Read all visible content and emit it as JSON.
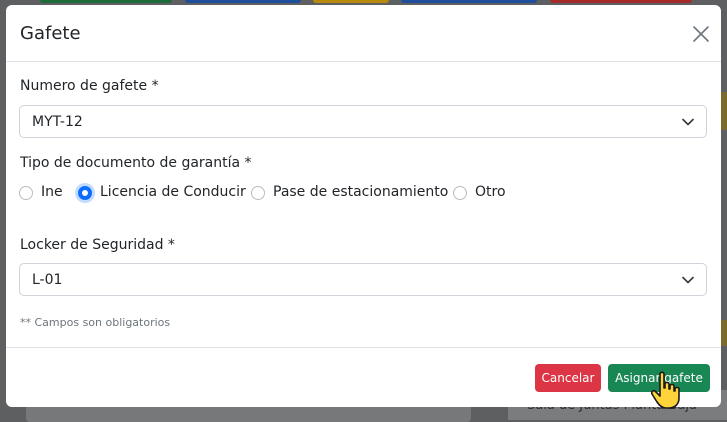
{
  "modal": {
    "title": "Gafete",
    "close_icon": "close-icon"
  },
  "form": {
    "badge_label": "Numero de gafete *",
    "badge_value": "MYT-12",
    "doc_type_label": "Tipo de documento de garantía *",
    "doc_types": [
      {
        "label": "Ine",
        "checked": false
      },
      {
        "label": "Licencia de Conducir",
        "checked": true
      },
      {
        "label": "Pase de estacionamiento",
        "checked": false
      },
      {
        "label": "Otro",
        "checked": false
      }
    ],
    "locker_label": "Locker de Seguridad *",
    "locker_value": "L-01",
    "required_hint": "** Campos son obligatorios"
  },
  "footer": {
    "cancel_label": "Cancelar",
    "assign_label": "Asignar gafete"
  },
  "background": {
    "card_text": "Sala de Juntas Planta Baja"
  },
  "colors": {
    "primary": "#0d6efd",
    "danger": "#dc3545",
    "success": "#198754"
  }
}
